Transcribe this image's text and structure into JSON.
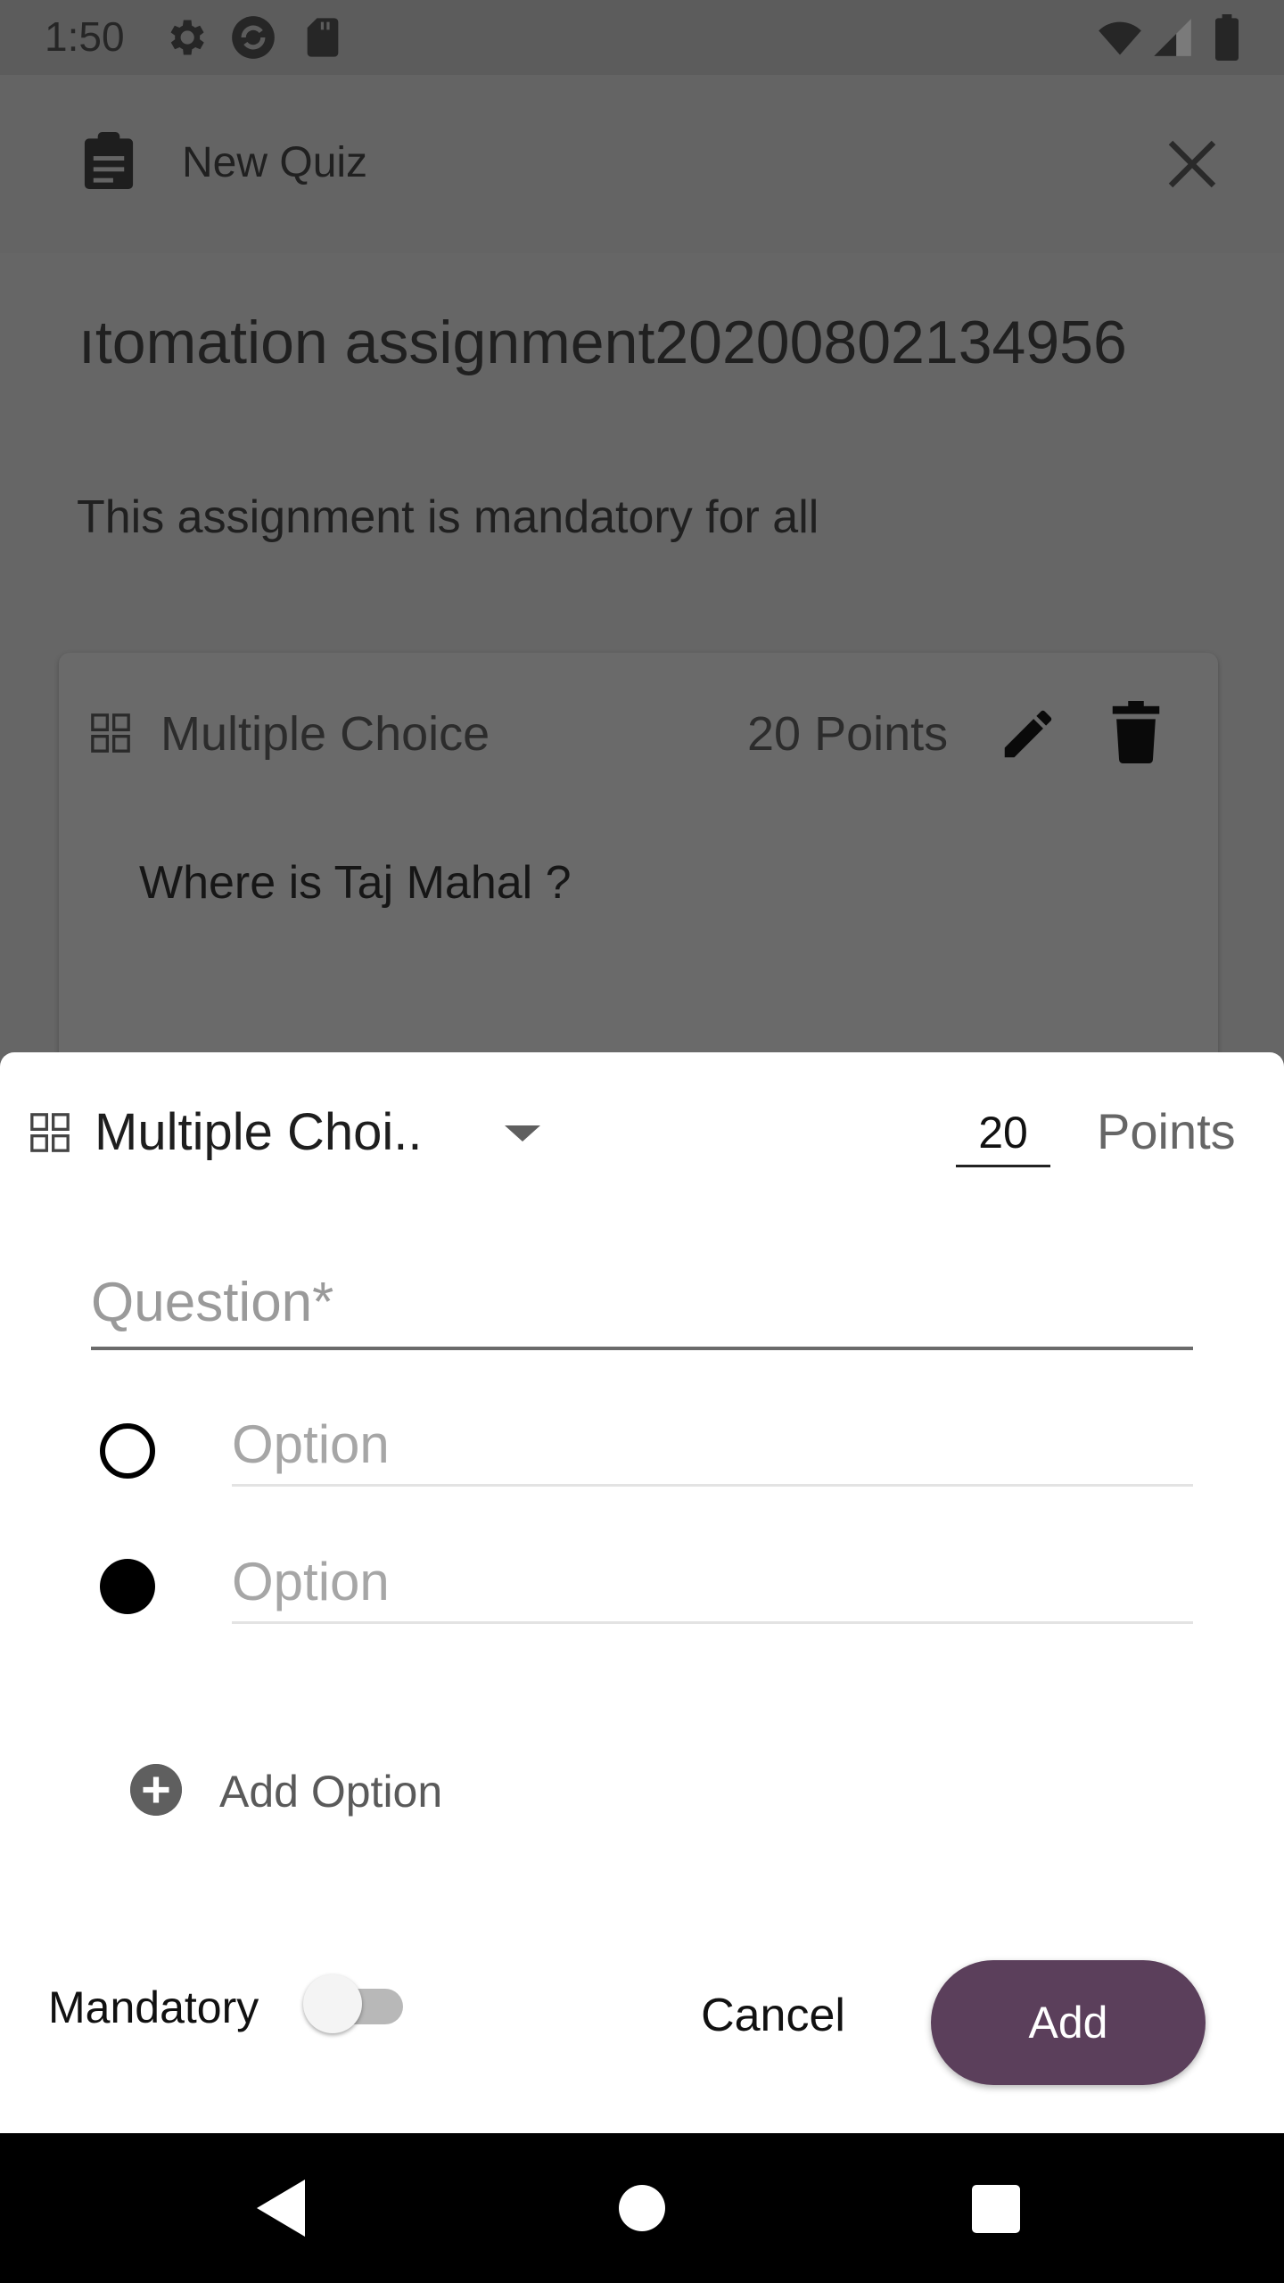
{
  "status_bar": {
    "time": "1:50",
    "left_icons": [
      "gear-icon",
      "sync-icon",
      "sd-card-icon"
    ],
    "right_icons": [
      "wifi-icon",
      "cellular-icon",
      "battery-icon"
    ]
  },
  "app_bar": {
    "title": "New Quiz",
    "icon": "clipboard-icon",
    "close_icon": "close-icon"
  },
  "quiz": {
    "title": "ıtomation assignment20200802134956",
    "description": "This assignment is mandatory for all"
  },
  "question_card": {
    "type": "Multiple Choice",
    "points": "20 Points",
    "question": "Where is Taj Mahal ?"
  },
  "sheet": {
    "type_label": "Multiple Choi..",
    "points_value": "20",
    "points_label": "Points",
    "question_placeholder": "Question*",
    "options": [
      {
        "placeholder": "Option",
        "selected": false
      },
      {
        "placeholder": "Option",
        "selected": true
      }
    ],
    "add_option_label": "Add Option",
    "mandatory_label": "Mandatory",
    "mandatory_on": false,
    "cancel_label": "Cancel",
    "add_label": "Add"
  },
  "colors": {
    "accent": "#5b3f5b",
    "scrim": "#666666",
    "sheet_bg": "#ffffff"
  }
}
